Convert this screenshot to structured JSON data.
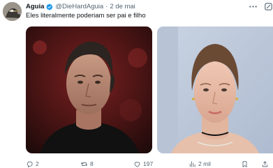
{
  "author": {
    "display_name": "Aguia",
    "handle": "@DieHardAguia",
    "separator": "·",
    "date": "2 de mai",
    "verified_icon": "verified-badge-icon",
    "verified_color": "#1d9bf0"
  },
  "post": {
    "text": "Eles literalmente poderiam ser pai e filho"
  },
  "media": [
    {
      "kind": "photo",
      "subject": "man with slicked-back hair in black shirt"
    },
    {
      "kind": "photo",
      "subject": "woman with pulled-back hair and choker"
    }
  ],
  "actions": {
    "reply": {
      "icon": "reply-icon",
      "count": "2"
    },
    "repost": {
      "icon": "repost-icon",
      "count": "8"
    },
    "like": {
      "icon": "heart-icon",
      "count": "197"
    },
    "views": {
      "icon": "views-icon",
      "count": "2 mil"
    },
    "bookmark": {
      "icon": "bookmark-icon"
    },
    "share": {
      "icon": "share-icon"
    }
  },
  "colors": {
    "text_primary": "#0f1419",
    "text_secondary": "#536471",
    "accent": "#1d9bf0"
  }
}
